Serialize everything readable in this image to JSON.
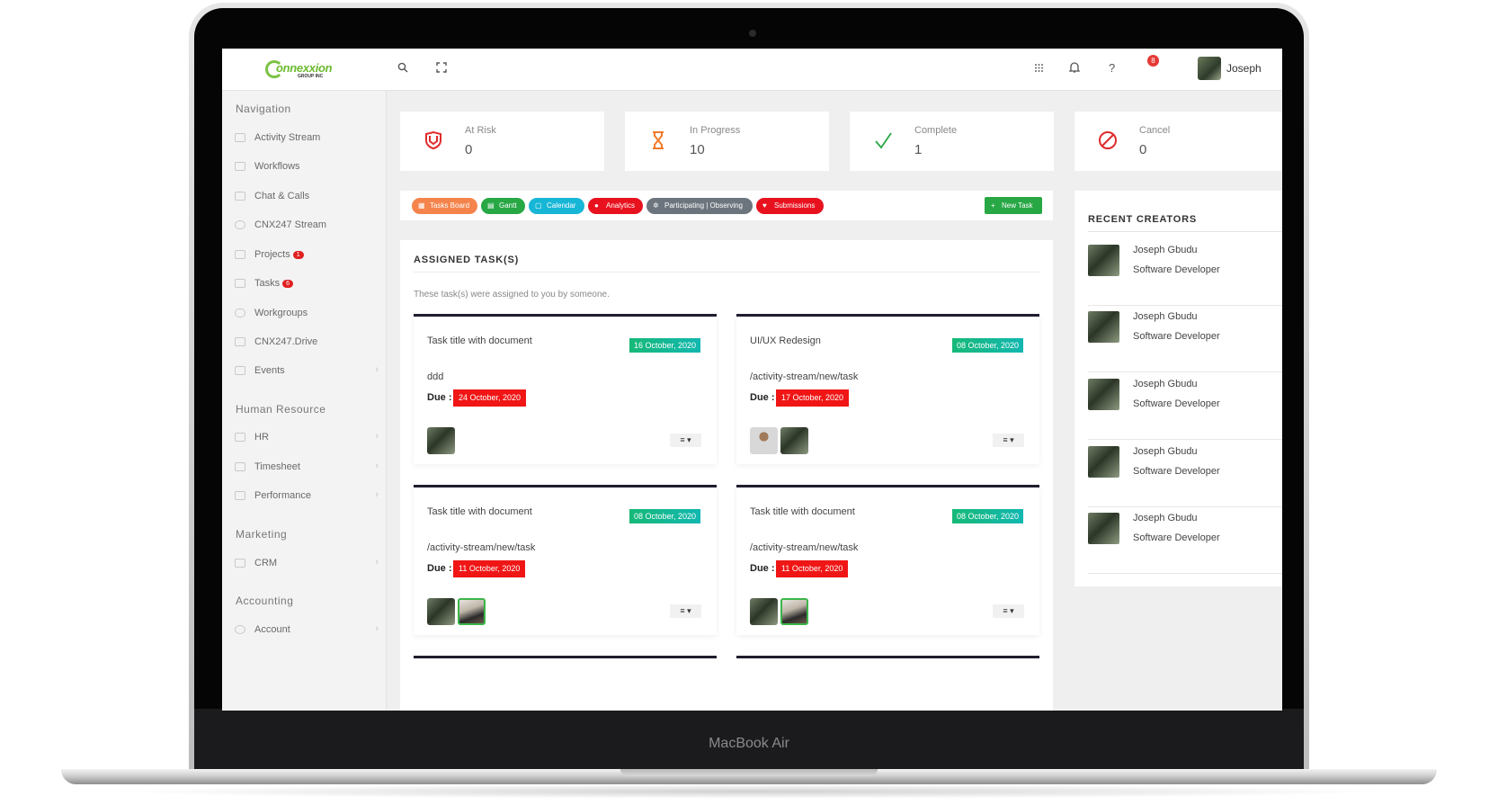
{
  "device": {
    "brand_label": "MacBook Air"
  },
  "topbar": {
    "logo_text": "onnexxion",
    "logo_sub": "GROUP INC",
    "notification_count": "8",
    "user_name": "Joseph"
  },
  "sidebar": {
    "sections": [
      "Navigation",
      "Human Resource",
      "Marketing",
      "Accounting"
    ],
    "items": [
      {
        "label": "Activity Stream"
      },
      {
        "label": "Workflows"
      },
      {
        "label": "Chat & Calls"
      },
      {
        "label": "CNX247 Stream"
      },
      {
        "label": "Projects",
        "badge": "1"
      },
      {
        "label": "Tasks",
        "badge": "6"
      },
      {
        "label": "Workgroups"
      },
      {
        "label": "CNX247.Drive"
      },
      {
        "label": "Events"
      },
      {
        "label": "HR"
      },
      {
        "label": "Timesheet"
      },
      {
        "label": "Performance"
      },
      {
        "label": "CRM"
      },
      {
        "label": "Account"
      }
    ]
  },
  "stats": [
    {
      "label": "At Risk",
      "value": "0",
      "icon": "shield-icon",
      "color": "#e02b2b"
    },
    {
      "label": "In Progress",
      "value": "10",
      "icon": "hourglass-icon",
      "color": "#f07b2c"
    },
    {
      "label": "Complete",
      "value": "1",
      "icon": "check-icon",
      "color": "#28a745"
    },
    {
      "label": "Cancel",
      "value": "0",
      "icon": "ban-icon",
      "color": "#e02b2b"
    }
  ],
  "tabs": [
    {
      "label": "Tasks Board",
      "color": "#f4844c"
    },
    {
      "label": "Gantt",
      "color": "#28a745"
    },
    {
      "label": "Calendar",
      "color": "#17b6d6"
    },
    {
      "label": "Analytics",
      "color": "#e8121f"
    },
    {
      "label": "Participating | Observing",
      "color": "#6c757d"
    },
    {
      "label": "Submissions",
      "color": "#e8121f"
    }
  ],
  "new_task_label": "New Task",
  "tasks_panel": {
    "title": "ASSIGNED TASK(S)",
    "subtitle": "These task(s) were assigned to you by someone.",
    "due_label": "Due :",
    "cards": [
      {
        "title": "Task title with document",
        "date": "16 October, 2020",
        "description": "ddd",
        "due": "24 October, 2020"
      },
      {
        "title": "UI/UX Redesign",
        "date": "08 October, 2020",
        "description": "/activity-stream/new/task",
        "due": "17 October, 2020"
      },
      {
        "title": "Task title with document",
        "date": "08 October, 2020",
        "description": "/activity-stream/new/task",
        "due": "11 October, 2020"
      },
      {
        "title": "Task title with document",
        "date": "08 October, 2020",
        "description": "/activity-stream/new/task",
        "due": "11 October, 2020"
      }
    ]
  },
  "recent_creators": {
    "title": "RECENT CREATORS",
    "items": [
      {
        "name": "Joseph Gbudu",
        "role": "Software Developer"
      },
      {
        "name": "Joseph Gbudu",
        "role": "Software Developer"
      },
      {
        "name": "Joseph Gbudu",
        "role": "Software Developer"
      },
      {
        "name": "Joseph Gbudu",
        "role": "Software Developer"
      },
      {
        "name": "Joseph Gbudu",
        "role": "Software Developer"
      }
    ]
  }
}
